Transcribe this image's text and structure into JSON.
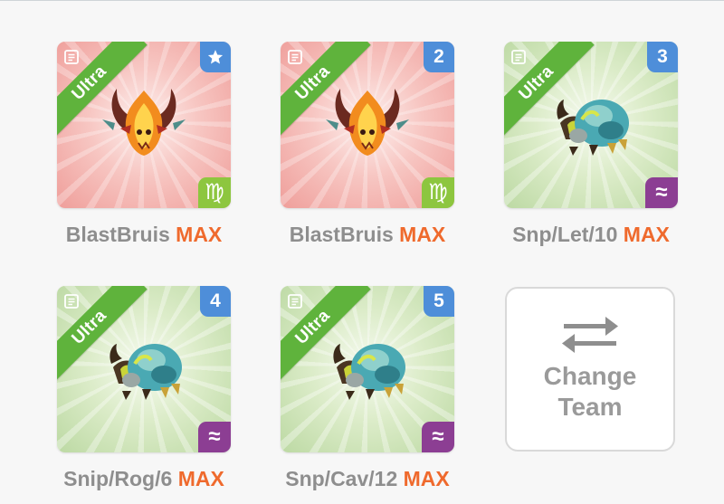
{
  "team": [
    {
      "rarity": "Ultra",
      "badge": "star",
      "badge_kind": "star-icon",
      "element": "♍",
      "element_name": "virgo-element-icon",
      "theme": "fire",
      "monster": "blastbruis",
      "name": "BlastBruis",
      "level_tag": "MAX"
    },
    {
      "rarity": "Ultra",
      "badge": "2",
      "element": "♍",
      "element_name": "virgo-element-icon",
      "theme": "fire",
      "monster": "blastbruis",
      "name": "BlastBruis",
      "level_tag": "MAX"
    },
    {
      "rarity": "Ultra",
      "badge": "3",
      "element": "≈",
      "element_name": "water-element-icon",
      "theme": "water",
      "monster": "snipper",
      "name": "Snp/Let/10",
      "level_tag": "MAX"
    },
    {
      "rarity": "Ultra",
      "badge": "4",
      "element": "≈",
      "element_name": "water-element-icon",
      "theme": "water",
      "monster": "snipper",
      "name": "Snip/Rog/6",
      "level_tag": "MAX"
    },
    {
      "rarity": "Ultra",
      "badge": "5",
      "element": "≈",
      "element_name": "water-element-icon",
      "theme": "water",
      "monster": "snipper",
      "name": "Snp/Cav/12",
      "level_tag": "MAX"
    }
  ],
  "change_team": {
    "line1": "Change",
    "line2": "Team",
    "icon": "swap-arrows-icon"
  },
  "colors": {
    "ultra_banner": "#5fb33c",
    "badge_blue": "#4e8ed9",
    "max_orange": "#ef6a2d",
    "name_gray": "#8e8e8e",
    "virgo_green": "#8dc63f",
    "water_purple": "#8c3e93"
  }
}
